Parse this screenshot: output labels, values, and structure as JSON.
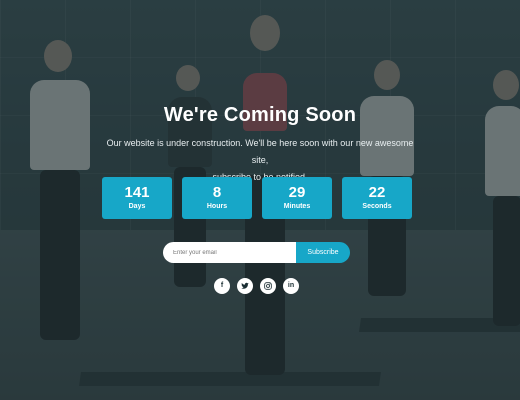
{
  "hero": {
    "title": "We're Coming Soon",
    "subtitle_line1": "Our website is under construction. We'll be here soon with our new awesome site,",
    "subtitle_line2": "subscribe to be notified."
  },
  "countdown": [
    {
      "value": "141",
      "label": "Days"
    },
    {
      "value": "8",
      "label": "Hours"
    },
    {
      "value": "29",
      "label": "Minutes"
    },
    {
      "value": "22",
      "label": "Seconds"
    }
  ],
  "subscribe": {
    "email_placeholder": "Enter your email",
    "button_label": "Subscribe"
  },
  "socials": [
    {
      "icon": "facebook-icon",
      "glyph": "f"
    },
    {
      "icon": "twitter-icon",
      "glyph": "t"
    },
    {
      "icon": "instagram-icon",
      "glyph": "◎"
    },
    {
      "icon": "linkedin-icon",
      "glyph": "in"
    }
  ],
  "colors": {
    "accent": "#17a7c8",
    "overlay": "#1c2c30",
    "text": "#ffffff"
  }
}
